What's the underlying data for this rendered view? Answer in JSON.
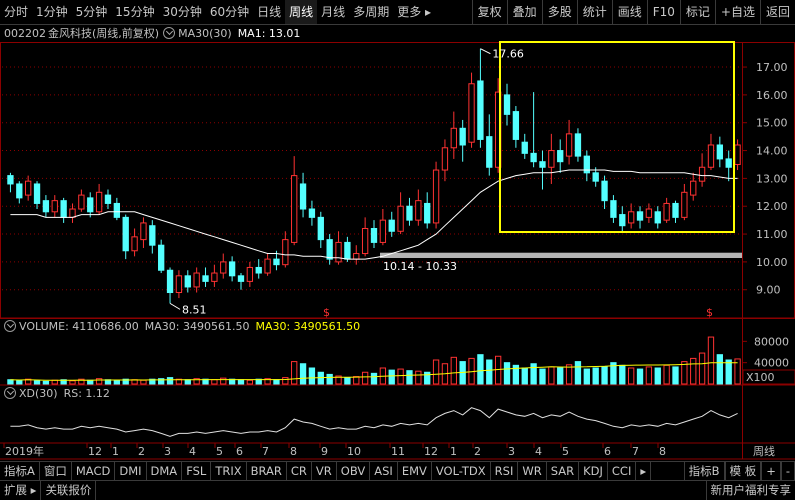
{
  "toolbar": {
    "left": [
      "分时",
      "1分钟",
      "5分钟",
      "15分钟",
      "30分钟",
      "60分钟",
      "日线",
      "周线",
      "月线",
      "多周期",
      "更多 ▸"
    ],
    "active_index": 7,
    "right": [
      "复权",
      "叠加",
      "多股",
      "统计",
      "画线",
      "F10",
      "标记",
      "+自选",
      "返回"
    ]
  },
  "title": {
    "code": "002202",
    "name": "金风科技(周线,前复权)",
    "ma_label": "MA30(30)",
    "ma1": "MA1: 13.01"
  },
  "price_axis": [
    "17.00",
    "16.00",
    "15.00",
    "14.00",
    "13.00",
    "12.00",
    "11.00",
    "10.00",
    "9.00"
  ],
  "annotations": {
    "high": "17.66",
    "low": "8.51",
    "range": "10.14 - 10.33",
    "marker": "$"
  },
  "volume": {
    "label": "VOLUME: 4110686.00",
    "ma30": "MA30: 3490561.50",
    "ma30b": "MA30: 3490561.50",
    "axis": [
      "80000",
      "40000"
    ],
    "unit": "X100"
  },
  "xd": {
    "label": "XD(30)",
    "rs": "RS: 1.12"
  },
  "time_axis": {
    "labels": [
      "2019年",
      "12",
      "1",
      "2",
      "3",
      "4",
      "5",
      "6",
      "7",
      "8",
      "9",
      "10",
      "11",
      "12",
      "1",
      "2",
      "3",
      "4",
      "5",
      "6",
      "7",
      "8"
    ],
    "period": "周线"
  },
  "bottom_tabs": [
    "指标A",
    "窗口",
    "MACD",
    "DMI",
    "DMA",
    "FSL",
    "TRIX",
    "BRAR",
    "CR",
    "VR",
    "OBV",
    "ASI",
    "EMV",
    "VOL-TDX",
    "RSI",
    "WR",
    "SAR",
    "KDJ",
    "CCI",
    "▸"
  ],
  "bottom_right": [
    "指标B",
    "模 板",
    "+",
    "-"
  ],
  "status": {
    "expand": "扩展 ▸",
    "quote": "关联报价",
    "promo": "新用户福利专享"
  },
  "colors": {
    "up": "#ff3232",
    "down": "#54ffff",
    "ma": "#ffffff",
    "highlight": "#ffff00",
    "grid": "#8b0000"
  },
  "chart_data": {
    "type": "candlestick",
    "price_range": [
      8.2,
      17.9
    ],
    "candles": [
      [
        13.1,
        12.8,
        13.2,
        12.5
      ],
      [
        12.8,
        12.3,
        12.9,
        12.1
      ],
      [
        12.4,
        12.9,
        13.1,
        12.2
      ],
      [
        12.8,
        12.1,
        12.9,
        11.9
      ],
      [
        12.2,
        11.8,
        12.4,
        11.6
      ],
      [
        11.8,
        12.2,
        12.4,
        11.6
      ],
      [
        12.2,
        11.6,
        12.3,
        11.4
      ],
      [
        11.6,
        11.9,
        12.1,
        11.4
      ],
      [
        11.9,
        12.4,
        12.6,
        11.8
      ],
      [
        12.3,
        11.8,
        12.5,
        11.6
      ],
      [
        11.8,
        12.5,
        12.8,
        11.7
      ],
      [
        12.4,
        12.1,
        12.6,
        11.9
      ],
      [
        12.1,
        11.6,
        12.3,
        11.5
      ],
      [
        11.6,
        10.4,
        11.7,
        10.1
      ],
      [
        10.4,
        10.9,
        11.2,
        10.2
      ],
      [
        10.8,
        11.4,
        11.6,
        10.5
      ],
      [
        11.3,
        10.6,
        11.5,
        10.3
      ],
      [
        10.6,
        9.7,
        10.8,
        9.6
      ],
      [
        9.7,
        8.9,
        9.8,
        8.51
      ],
      [
        8.9,
        9.5,
        9.7,
        8.7
      ],
      [
        9.5,
        9.1,
        9.7,
        8.9
      ],
      [
        9.1,
        9.6,
        9.8,
        8.9
      ],
      [
        9.5,
        9.3,
        9.8,
        9.1
      ],
      [
        9.3,
        9.6,
        9.9,
        9.1
      ],
      [
        9.6,
        10.0,
        10.3,
        9.4
      ],
      [
        10.0,
        9.5,
        10.2,
        9.3
      ],
      [
        9.5,
        9.3,
        9.6,
        9.0
      ],
      [
        9.3,
        9.8,
        10.0,
        9.1
      ],
      [
        9.8,
        9.6,
        10.1,
        9.4
      ],
      [
        9.6,
        10.1,
        10.3,
        9.5
      ],
      [
        10.1,
        9.9,
        10.4,
        9.7
      ],
      [
        9.9,
        10.8,
        11.1,
        9.8
      ],
      [
        10.7,
        13.1,
        13.8,
        10.6
      ],
      [
        12.8,
        11.9,
        13.2,
        11.6
      ],
      [
        11.9,
        11.6,
        12.2,
        11.3
      ],
      [
        11.6,
        10.8,
        11.8,
        10.5
      ],
      [
        10.8,
        10.1,
        11.0,
        9.9
      ],
      [
        10.0,
        10.7,
        11.1,
        9.9
      ],
      [
        10.7,
        10.1,
        10.9,
        10.0
      ],
      [
        10.1,
        10.3,
        10.6,
        9.9
      ],
      [
        10.3,
        11.2,
        11.6,
        10.2
      ],
      [
        11.2,
        10.7,
        11.5,
        10.5
      ],
      [
        10.7,
        11.5,
        11.9,
        10.6
      ],
      [
        11.5,
        11.1,
        11.8,
        10.9
      ],
      [
        11.1,
        12.0,
        12.5,
        11.0
      ],
      [
        12.0,
        11.5,
        12.3,
        11.3
      ],
      [
        11.5,
        12.2,
        12.6,
        11.3
      ],
      [
        12.1,
        11.4,
        12.5,
        11.2
      ],
      [
        11.4,
        13.3,
        13.6,
        11.2
      ],
      [
        13.3,
        14.1,
        14.4,
        12.9
      ],
      [
        14.1,
        14.8,
        15.4,
        13.7
      ],
      [
        14.8,
        14.2,
        15.1,
        13.6
      ],
      [
        14.3,
        16.4,
        16.8,
        14.1
      ],
      [
        16.5,
        14.4,
        17.66,
        14.1
      ],
      [
        14.5,
        13.4,
        15.3,
        13.1
      ],
      [
        13.4,
        16.1,
        16.6,
        13.2
      ],
      [
        16.0,
        15.3,
        16.4,
        14.9
      ],
      [
        15.4,
        14.4,
        15.6,
        14.1
      ],
      [
        14.3,
        13.9,
        14.6,
        13.7
      ],
      [
        13.9,
        13.6,
        16.1,
        13.4
      ],
      [
        13.6,
        13.4,
        14.0,
        12.6
      ],
      [
        13.4,
        14.0,
        14.6,
        12.8
      ],
      [
        14.0,
        13.6,
        14.4,
        13.2
      ],
      [
        13.8,
        14.6,
        15.1,
        13.5
      ],
      [
        14.6,
        13.8,
        14.8,
        13.6
      ],
      [
        13.8,
        13.2,
        14.0,
        12.9
      ],
      [
        13.2,
        12.9,
        13.4,
        12.7
      ],
      [
        12.9,
        12.2,
        13.1,
        11.9
      ],
      [
        12.2,
        11.6,
        12.4,
        11.4
      ],
      [
        11.7,
        11.3,
        12.0,
        11.1
      ],
      [
        11.4,
        11.8,
        12.1,
        11.2
      ],
      [
        11.8,
        11.5,
        12.0,
        11.2
      ],
      [
        11.6,
        11.9,
        12.1,
        11.4
      ],
      [
        11.8,
        11.4,
        12.0,
        11.2
      ],
      [
        11.5,
        12.1,
        12.3,
        11.4
      ],
      [
        12.1,
        11.6,
        12.2,
        11.4
      ],
      [
        11.6,
        12.5,
        12.8,
        11.5
      ],
      [
        12.4,
        12.9,
        13.2,
        12.2
      ],
      [
        12.9,
        13.4,
        13.9,
        12.7
      ],
      [
        13.4,
        14.2,
        14.6,
        13.3
      ],
      [
        14.2,
        13.7,
        14.5,
        13.4
      ],
      [
        13.7,
        13.4,
        14.0,
        12.9
      ],
      [
        13.5,
        14.2,
        14.4,
        13.3
      ]
    ],
    "ma30": [
      11.7,
      11.7,
      11.7,
      11.7,
      11.6,
      11.6,
      11.6,
      11.6,
      11.7,
      11.7,
      11.7,
      11.8,
      11.8,
      11.8,
      11.8,
      11.7,
      11.6,
      11.5,
      11.4,
      11.3,
      11.2,
      11.1,
      11.0,
      10.9,
      10.8,
      10.7,
      10.6,
      10.5,
      10.4,
      10.3,
      10.3,
      10.25,
      10.25,
      10.2,
      10.2,
      10.2,
      10.15,
      10.15,
      10.1,
      10.1,
      10.1,
      10.15,
      10.2,
      10.3,
      10.4,
      10.5,
      10.6,
      10.8,
      11.0,
      11.3,
      11.6,
      11.9,
      12.2,
      12.5,
      12.7,
      12.9,
      13.0,
      13.1,
      13.15,
      13.2,
      13.2,
      13.2,
      13.25,
      13.3,
      13.3,
      13.3,
      13.3,
      13.3,
      13.25,
      13.25,
      13.25,
      13.2,
      13.2,
      13.2,
      13.2,
      13.2,
      13.2,
      13.15,
      13.1,
      13.1,
      13.05,
      13.0,
      13.0
    ],
    "volume": [
      8000,
      7000,
      9000,
      6000,
      5000,
      7000,
      8000,
      6000,
      9000,
      7000,
      10000,
      8000,
      7000,
      9000,
      8000,
      7000,
      9000,
      10000,
      12000,
      9000,
      8000,
      10000,
      9000,
      8000,
      11000,
      9000,
      8000,
      7000,
      9000,
      10000,
      8000,
      12000,
      42000,
      38000,
      30000,
      22000,
      18000,
      15000,
      12000,
      14000,
      22000,
      20000,
      30000,
      26000,
      28000,
      25000,
      24000,
      22000,
      45000,
      38000,
      50000,
      42000,
      48000,
      55000,
      45000,
      52000,
      40000,
      35000,
      30000,
      38000,
      28000,
      32000,
      30000,
      36000,
      42000,
      28000,
      30000,
      32000,
      40000,
      35000,
      30000,
      28000,
      32000,
      30000,
      35000,
      32000,
      42000,
      48000,
      58000,
      88000,
      55000,
      45000,
      47000
    ],
    "volume_range": [
      0,
      90000
    ],
    "xd": [
      0.97,
      0.97,
      0.98,
      0.96,
      0.95,
      0.96,
      0.95,
      0.95,
      0.97,
      0.96,
      0.97,
      0.96,
      0.95,
      0.93,
      0.94,
      0.95,
      0.94,
      0.92,
      0.9,
      0.92,
      0.92,
      0.93,
      0.92,
      0.93,
      0.94,
      0.93,
      0.92,
      0.93,
      0.93,
      0.94,
      0.93,
      0.96,
      1.02,
      1.0,
      0.99,
      0.97,
      0.95,
      0.96,
      0.95,
      0.95,
      0.97,
      0.96,
      0.98,
      0.97,
      0.99,
      0.98,
      0.99,
      0.98,
      1.03,
      1.06,
      1.08,
      1.05,
      1.1,
      1.08,
      1.03,
      1.09,
      1.07,
      1.05,
      1.04,
      1.06,
      1.03,
      1.05,
      1.04,
      1.07,
      1.04,
      1.02,
      1.01,
      0.99,
      0.97,
      0.96,
      0.98,
      0.97,
      0.98,
      0.97,
      0.99,
      0.98,
      1.0,
      1.02,
      1.04,
      1.08,
      1.05,
      1.03,
      1.06
    ],
    "xd_range": [
      0.86,
      1.14
    ]
  }
}
